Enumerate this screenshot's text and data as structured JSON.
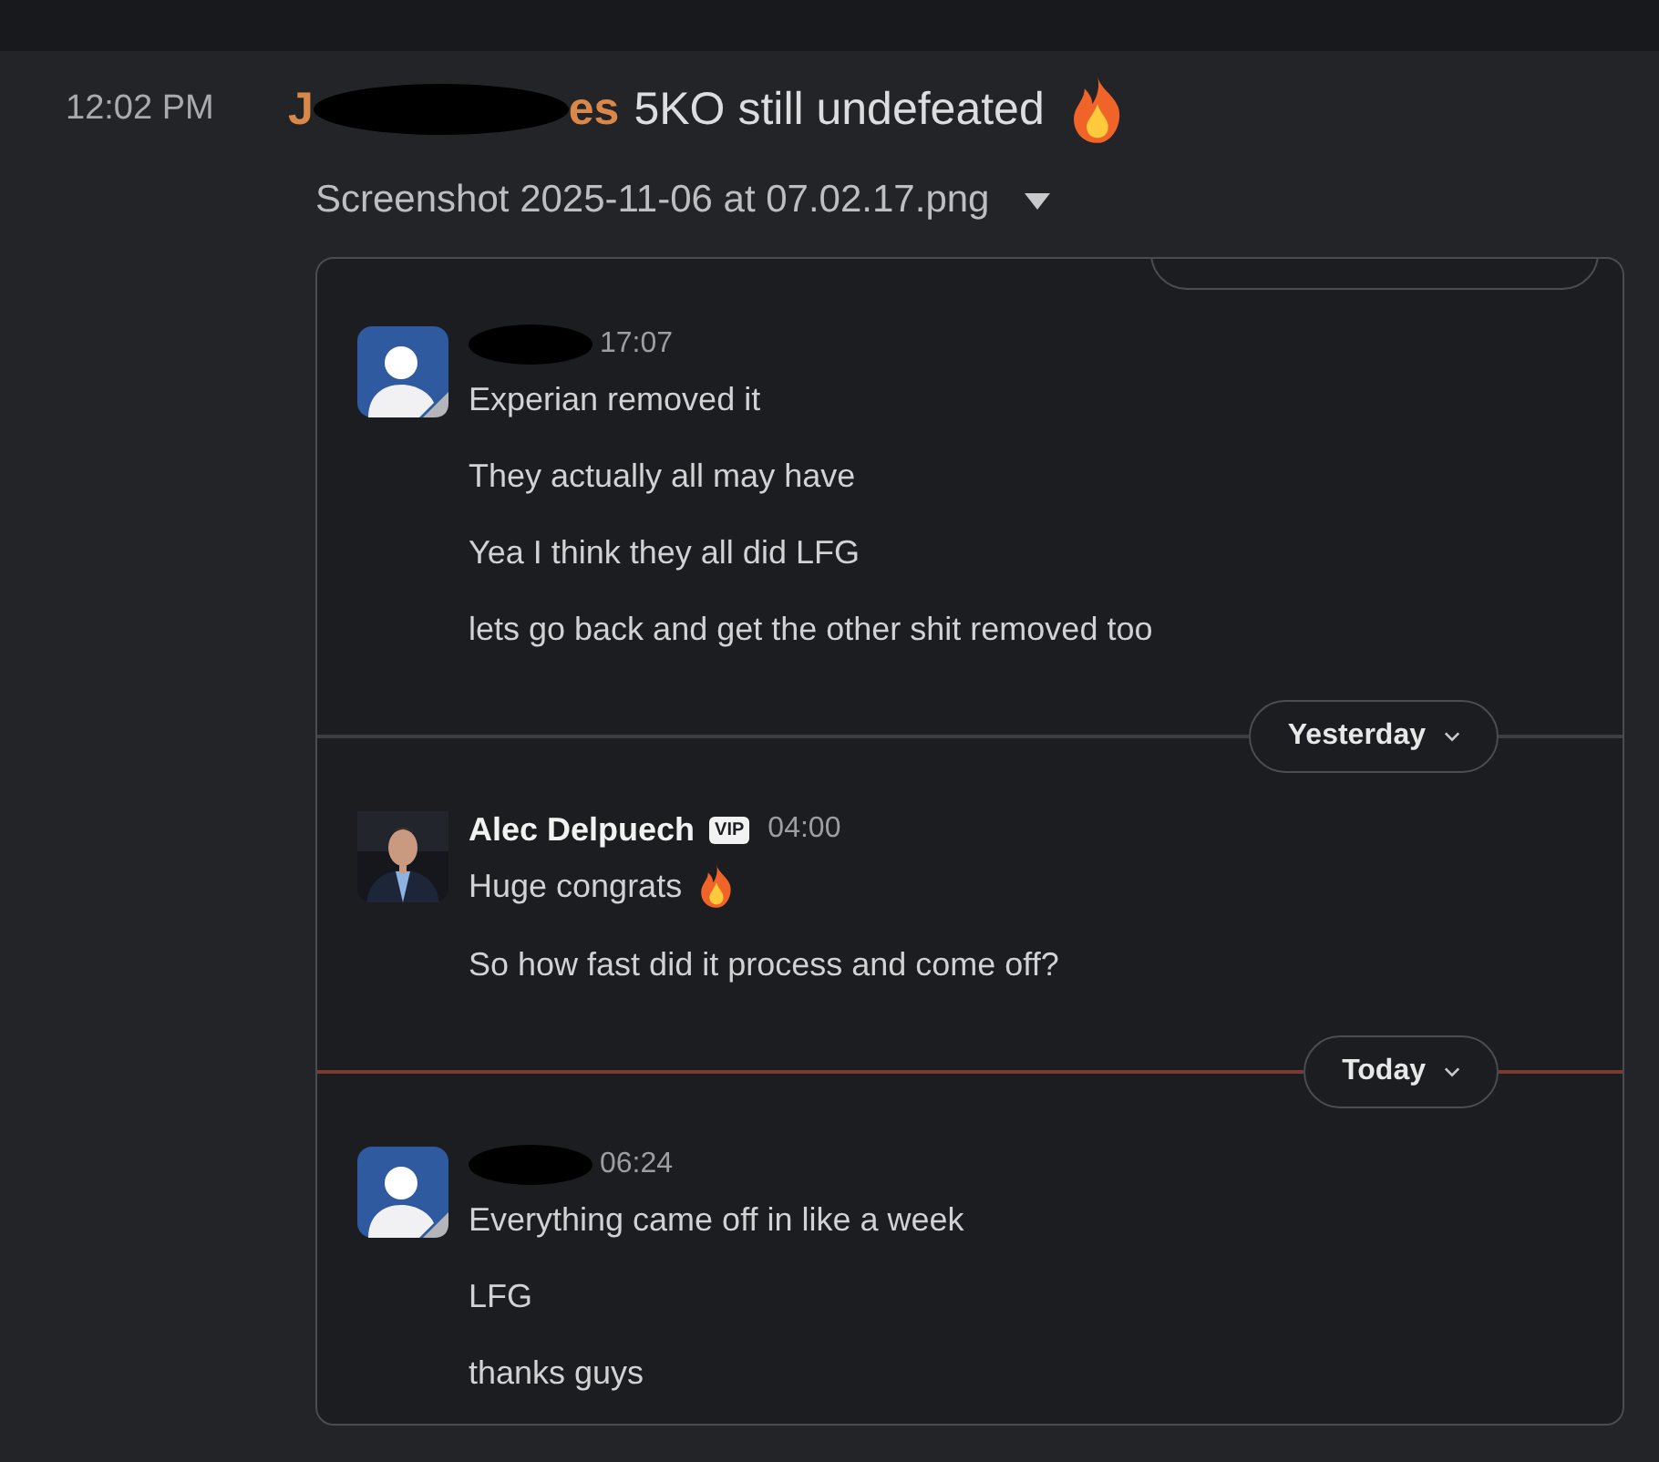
{
  "message": {
    "time": "12:02 PM",
    "sender": {
      "visible_start": "J",
      "visible_end": "es",
      "redacted": true
    },
    "text": "5KO still undefeated",
    "emoji": {
      "kind": "fire"
    },
    "attachment": {
      "filename": "Screenshot 2025-11-06 at 07.02.17.png",
      "expanded": true,
      "sections": [
        {
          "divider": {
            "kind": "cut"
          },
          "messages": [
            {
              "avatar": {
                "kind": "default"
              },
              "name_redacted": true,
              "time": "17:07",
              "lines": [
                {
                  "text": "Experian removed it"
                },
                {
                  "text": "They actually all may have"
                },
                {
                  "text": "Yea I think they all did LFG"
                },
                {
                  "text": "lets go back and get the other shit removed too"
                }
              ]
            }
          ]
        },
        {
          "divider": {
            "kind": "pill",
            "label": "Yesterday",
            "new": false
          },
          "messages": [
            {
              "avatar": {
                "kind": "picture"
              },
              "name_redacted": false,
              "name": "Alec Delpuech",
              "badge": "VIP",
              "time": "04:00",
              "lines": [
                {
                  "text": "Huge congrats",
                  "emoji": {
                    "kind": "fire"
                  }
                },
                {
                  "text": "So how fast did it process and come off?"
                }
              ]
            }
          ]
        },
        {
          "divider": {
            "kind": "pill",
            "label": "Today",
            "new": true
          },
          "messages": [
            {
              "avatar": {
                "kind": "default"
              },
              "name_redacted": true,
              "time": "06:24",
              "lines": [
                {
                  "text": "Everything came off in like a week"
                },
                {
                  "text": "LFG"
                },
                {
                  "text": "thanks guys"
                }
              ]
            }
          ]
        }
      ]
    }
  }
}
